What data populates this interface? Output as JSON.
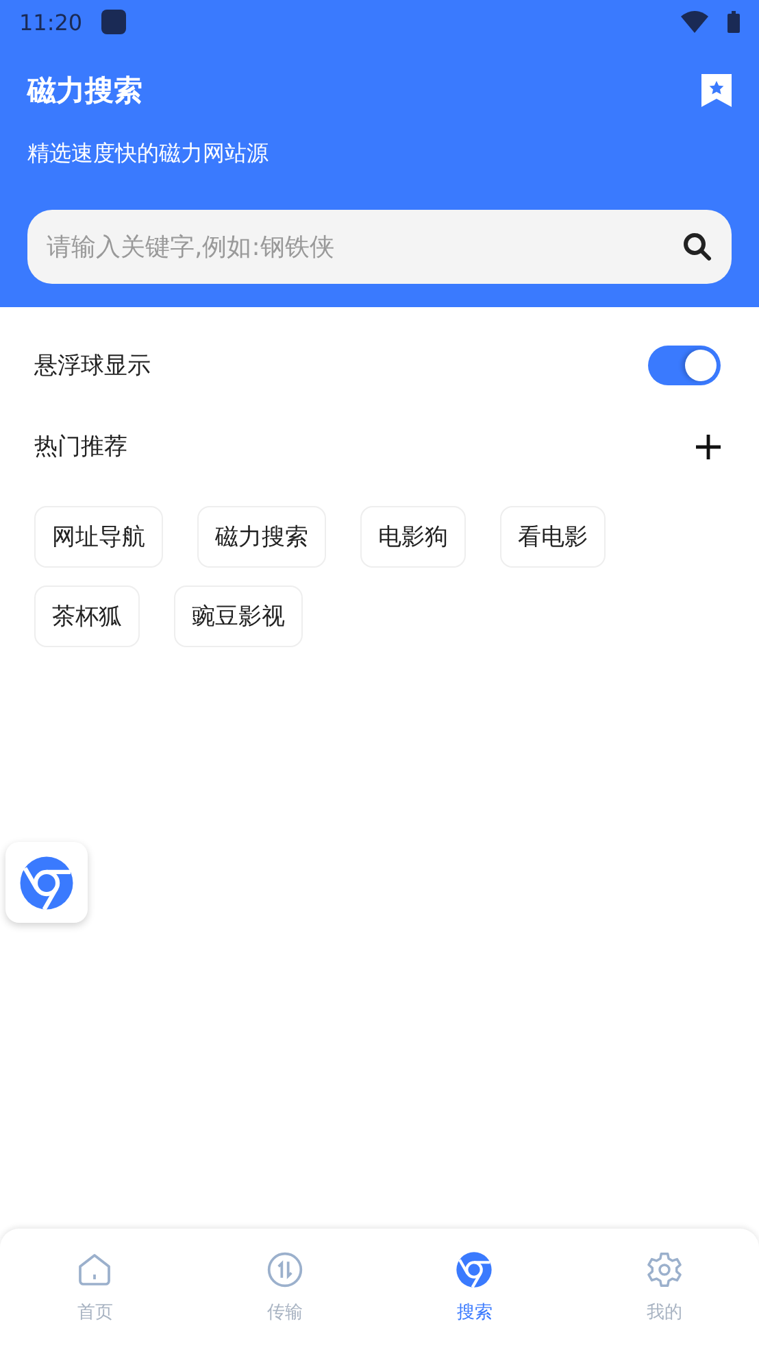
{
  "status_bar": {
    "time": "11:20"
  },
  "header": {
    "title": "磁力搜索",
    "subtitle": "精选速度快的磁力网站源"
  },
  "search": {
    "placeholder": "请输入关键字,例如:钢铁侠"
  },
  "floating_ball": {
    "label": "悬浮球显示",
    "on": true
  },
  "hot": {
    "title": "热门推荐",
    "tags": [
      "网址导航",
      "磁力搜索",
      "电影狗",
      "看电影",
      "茶杯狐",
      "豌豆影视"
    ]
  },
  "tabs": [
    {
      "label": "首页",
      "kind": "home",
      "selected": false
    },
    {
      "label": "传输",
      "kind": "transfer",
      "selected": false
    },
    {
      "label": "搜索",
      "kind": "browser",
      "selected": true
    },
    {
      "label": "我的",
      "kind": "settings",
      "selected": false
    }
  ]
}
